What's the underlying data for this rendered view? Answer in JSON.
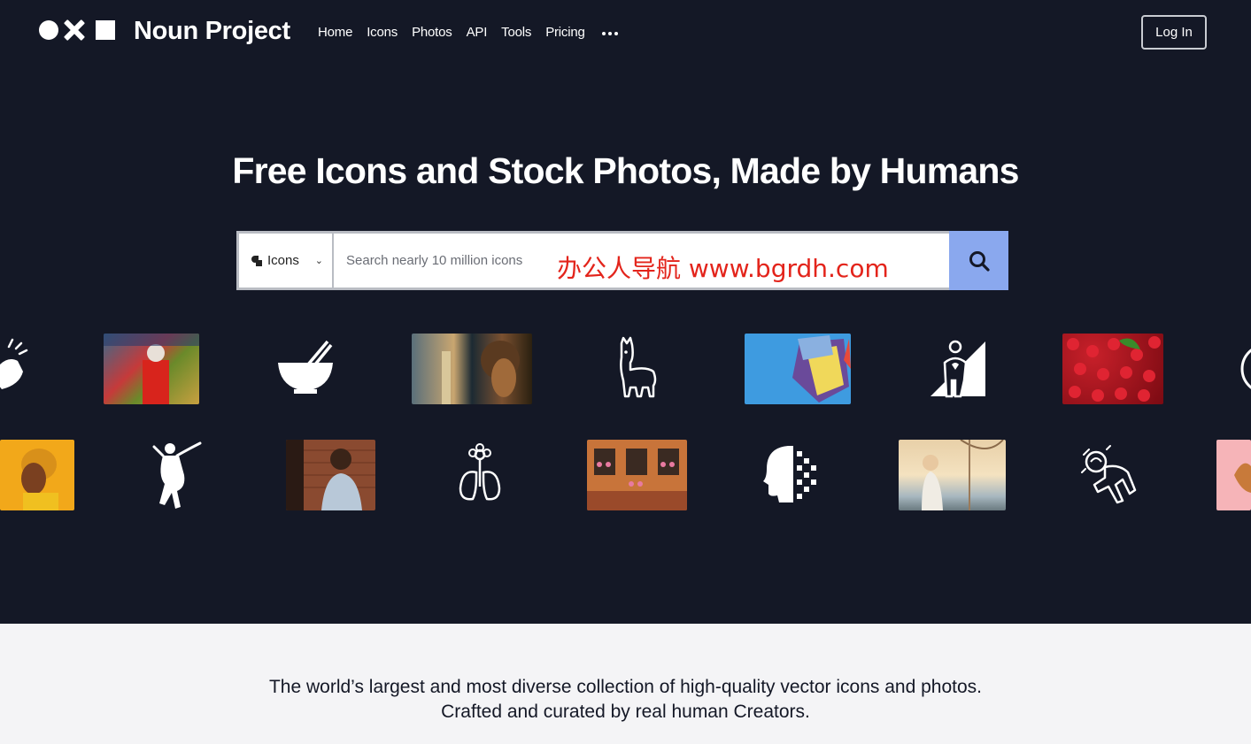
{
  "header": {
    "brand": "Noun Project",
    "nav": [
      "Home",
      "Icons",
      "Photos",
      "API",
      "Tools",
      "Pricing"
    ],
    "login_label": "Log In"
  },
  "hero": {
    "headline": "Free Icons and Stock Photos, Made by Humans"
  },
  "search": {
    "type_label": "Icons",
    "placeholder": "Search nearly 10 million icons",
    "overlay_text": "办公人导航  www.bgrdh.com"
  },
  "carousel": {
    "row1": [
      "clap-icon",
      "photo-graffiti-person",
      "bowl-chopsticks-icon",
      "photo-surfer-portrait",
      "llama-icon",
      "photo-blue-fabric",
      "person-ramp-icon",
      "photo-cherries",
      "partial-icon"
    ],
    "row2": [
      "photo-yellow-portrait",
      "dancer-icon",
      "photo-singer-brick",
      "flower-lungs-icon",
      "photo-building-facade",
      "pixel-head-icon",
      "photo-woman-boat",
      "astronaut-icon",
      "photo-pink-partial"
    ]
  },
  "tagline": {
    "line1": "The world’s largest and most diverse collection of high-quality vector icons and photos.",
    "line2": "Crafted and curated by real human Creators."
  },
  "colors": {
    "background_dark": "#141826",
    "background_light": "#f4f4f6",
    "search_button": "#8aa8ee",
    "watermark": "#e3241b"
  }
}
